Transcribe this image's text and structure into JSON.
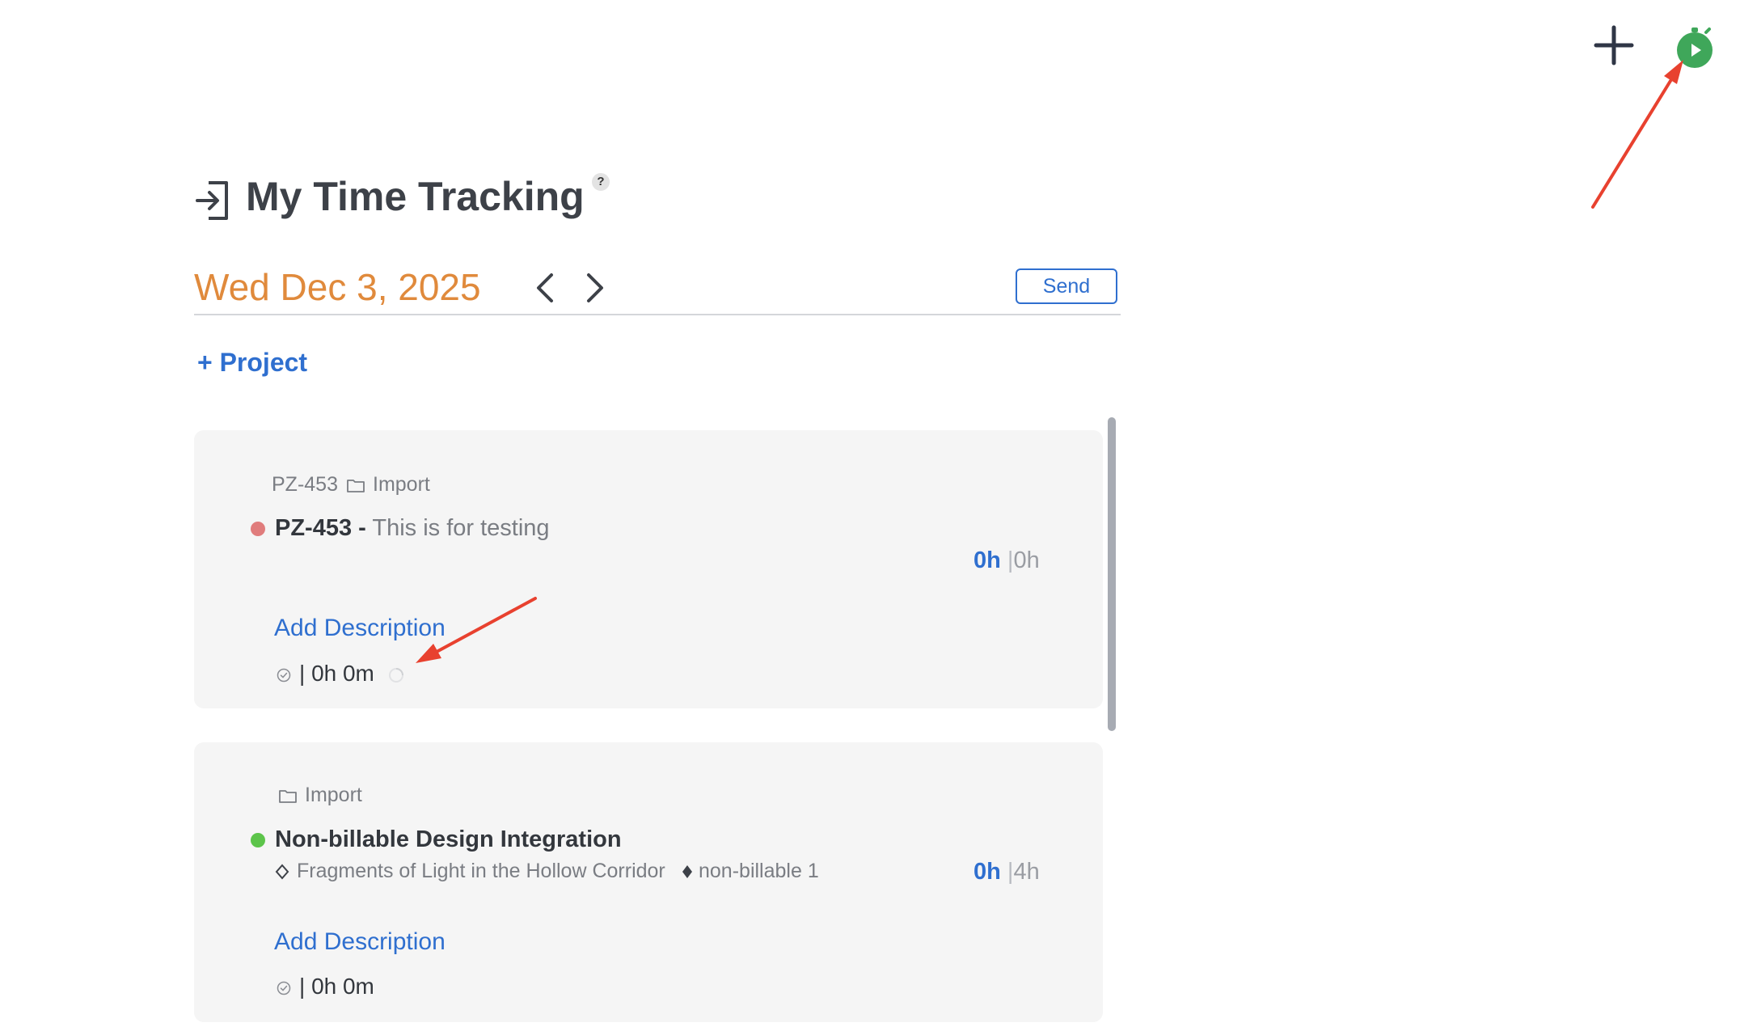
{
  "header": {
    "title": "My Time Tracking",
    "help_label": "?"
  },
  "toolbar": {
    "date": "Wed Dec 3, 2025",
    "send_label": "Send",
    "add_project_label": "+ Project"
  },
  "entries": [
    {
      "project_code": "PZ-453",
      "folder": "Import",
      "title_code": "PZ-453 -",
      "title_text": "This is for testing",
      "status_color": "#e07c7c",
      "logged": "0h",
      "separator": "|",
      "planned": "0h",
      "add_description_label": "Add Description",
      "time_separator": "|",
      "time_value": "0h 0m"
    },
    {
      "folder": "Import",
      "title": "Non-billable Design Integration",
      "status_color": "#5cc44a",
      "subtask_left": "Fragments of Light in the Hollow Corridor",
      "subtask_right": "non-billable 1",
      "logged": "0h",
      "separator": "|",
      "planned": "4h",
      "add_description_label": "Add Description",
      "time_separator": "|",
      "time_value": "0h 0m"
    }
  ],
  "colors": {
    "accent": "#2f6fcf",
    "date": "#e08a3c",
    "timer_green": "#3fa75a",
    "annotation_red": "#e8412f"
  },
  "icons": {
    "add": "plus-icon",
    "timer": "stopwatch-play-icon",
    "header": "sign-in-icon",
    "folder": "folder-icon",
    "check": "check-circle-icon",
    "spinner": "spinner-icon"
  }
}
